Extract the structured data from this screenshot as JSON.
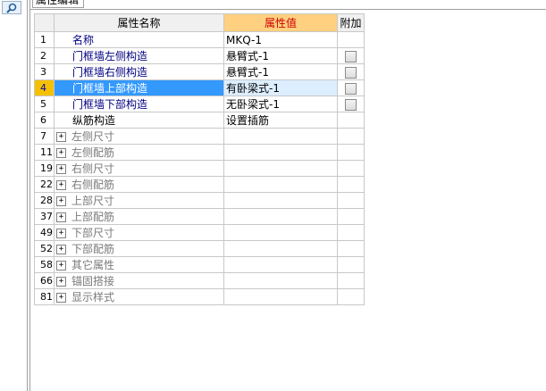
{
  "tab": {
    "label": "属性编辑"
  },
  "table": {
    "headers": {
      "num": "",
      "name": "属性名称",
      "value": "属性值",
      "extra": "附加"
    },
    "rows": [
      {
        "num": "1",
        "name": "名称",
        "value": "MKQ-1",
        "type": "prop"
      },
      {
        "num": "2",
        "name": "门框墙左侧构造",
        "value": "悬臂式-1",
        "type": "prop",
        "check": true
      },
      {
        "num": "3",
        "name": "门框墙右侧构造",
        "value": "悬臂式-1",
        "type": "prop",
        "check": true
      },
      {
        "num": "4",
        "name": "门框墙上部构造",
        "value": "有卧梁式-1",
        "type": "prop",
        "check": true,
        "selected": true
      },
      {
        "num": "5",
        "name": "门框墙下部构造",
        "value": "无卧梁式-1",
        "type": "prop",
        "check": true
      },
      {
        "num": "6",
        "name": "纵筋构造",
        "value": "设置插筋",
        "type": "plain"
      },
      {
        "num": "7",
        "name": "左侧尺寸",
        "value": "",
        "type": "group"
      },
      {
        "num": "11",
        "name": "左侧配筋",
        "value": "",
        "type": "group"
      },
      {
        "num": "19",
        "name": "右侧尺寸",
        "value": "",
        "type": "group"
      },
      {
        "num": "22",
        "name": "右侧配筋",
        "value": "",
        "type": "group"
      },
      {
        "num": "28",
        "name": "上部尺寸",
        "value": "",
        "type": "group"
      },
      {
        "num": "37",
        "name": "上部配筋",
        "value": "",
        "type": "group"
      },
      {
        "num": "49",
        "name": "下部尺寸",
        "value": "",
        "type": "group"
      },
      {
        "num": "52",
        "name": "下部配筋",
        "value": "",
        "type": "group"
      },
      {
        "num": "58",
        "name": "其它属性",
        "value": "",
        "type": "group"
      },
      {
        "num": "66",
        "name": "锚固搭接",
        "value": "",
        "type": "group"
      },
      {
        "num": "81",
        "name": "显示样式",
        "value": "",
        "type": "group"
      }
    ]
  },
  "icons": {
    "search": "search-icon",
    "expand": "expand-plus-icon",
    "checkbox": "checkbox-icon"
  },
  "colors": {
    "selection": "#3399ff",
    "header_value_bg": "#ffd080",
    "header_value_fg": "#cc0000",
    "link_text": "#000080"
  }
}
